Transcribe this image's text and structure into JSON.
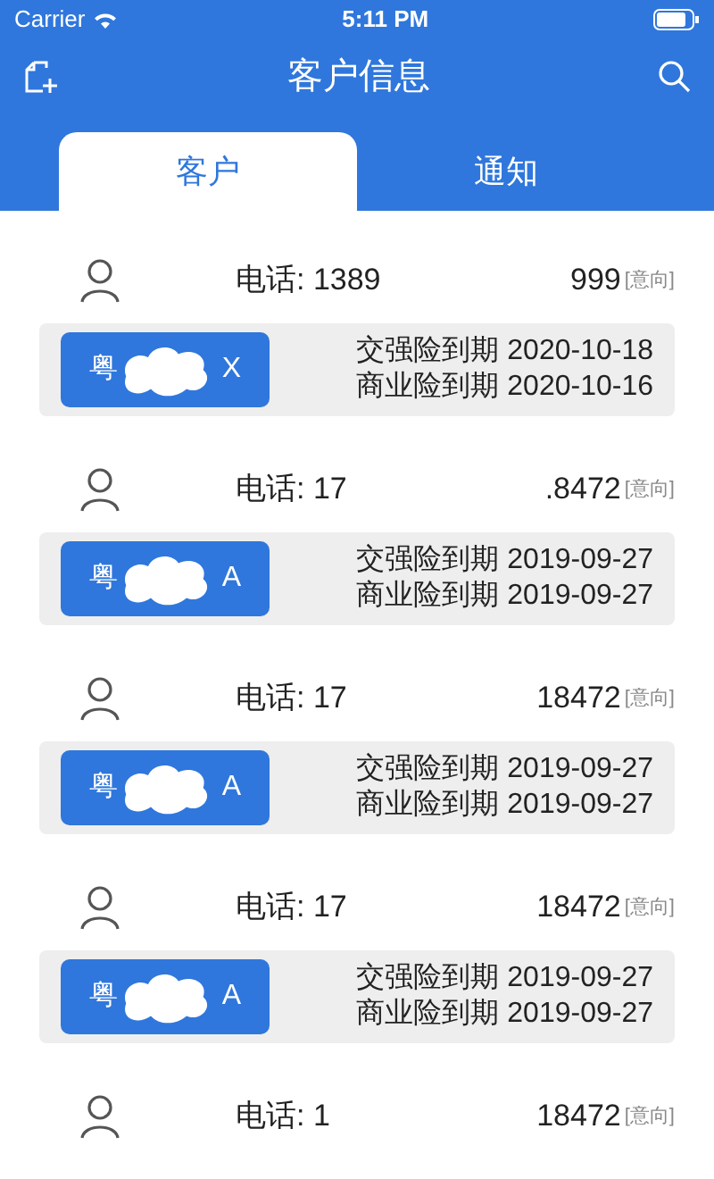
{
  "status_bar": {
    "carrier": "Carrier",
    "time": "5:11 PM"
  },
  "nav": {
    "title": "客户信息"
  },
  "tabs": [
    {
      "label": "客户",
      "selected": true
    },
    {
      "label": "通知",
      "selected": false
    }
  ],
  "customers": [
    {
      "phone_start": "电话: 1389",
      "phone_end": "999",
      "tag": "[意向]",
      "plate_start": "粤",
      "plate_end": "X",
      "insurance": [
        "交强险到期 2020-10-18",
        "商业险到期 2020-10-16"
      ]
    },
    {
      "phone_start": "电话: 17",
      "phone_end": ".8472",
      "tag": "[意向]",
      "plate_start": "粤",
      "plate_end": "A",
      "insurance": [
        "交强险到期 2019-09-27",
        "商业险到期 2019-09-27"
      ]
    },
    {
      "phone_start": "电话: 17",
      "phone_end": "18472",
      "tag": "[意向]",
      "plate_start": "粤",
      "plate_end": "A",
      "insurance": [
        "交强险到期 2019-09-27",
        "商业险到期 2019-09-27"
      ]
    },
    {
      "phone_start": "电话: 17",
      "phone_end": "18472",
      "tag": "[意向]",
      "plate_start": "粤",
      "plate_end": "A",
      "insurance": [
        "交强险到期 2019-09-27",
        "商业险到期 2019-09-27"
      ]
    },
    {
      "phone_start": "电话: 1",
      "phone_end": "18472",
      "tag": "[意向]"
    }
  ]
}
